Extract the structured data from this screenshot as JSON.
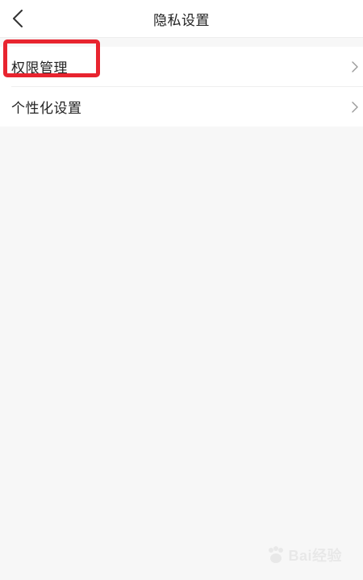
{
  "header": {
    "title": "隐私设置",
    "back_icon": "chevron-left-icon"
  },
  "settings": {
    "items": [
      {
        "label": "权限管理",
        "icon": "chevron-right-icon"
      },
      {
        "label": "个性化设置",
        "icon": "chevron-right-icon"
      }
    ]
  },
  "annotation": {
    "highlight_color": "#e8242f"
  },
  "watermark": {
    "text": "Bai经验"
  },
  "colors": {
    "background": "#f7f7f7",
    "surface": "#ffffff",
    "text": "#222222",
    "chevron": "#999999"
  }
}
